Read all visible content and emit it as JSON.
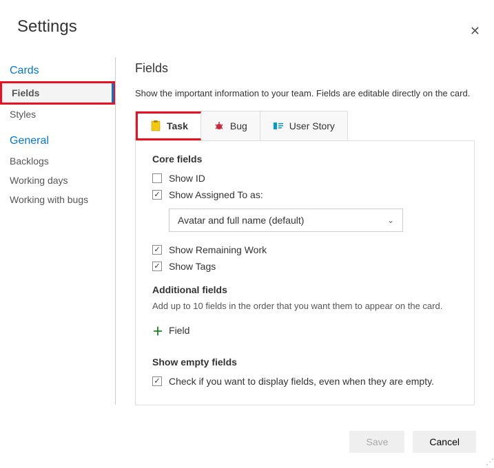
{
  "window": {
    "title": "Settings"
  },
  "sidebar": {
    "section_cards": "Cards",
    "item_fields": "Fields",
    "item_styles": "Styles",
    "section_general": "General",
    "item_backlogs": "Backlogs",
    "item_working_days": "Working days",
    "item_working_bugs": "Working with bugs"
  },
  "main": {
    "heading": "Fields",
    "description": "Show the important information to your team. Fields are editable directly on the card.",
    "tabs": {
      "task": "Task",
      "bug": "Bug",
      "user_story": "User Story"
    },
    "core_fields_label": "Core fields",
    "show_id": "Show ID",
    "show_assigned": "Show Assigned To as:",
    "assigned_select": "Avatar and full name (default)",
    "show_remaining": "Show Remaining Work",
    "show_tags": "Show Tags",
    "additional_label": "Additional fields",
    "additional_desc": "Add up to 10 fields in the order that you want them to appear on the card.",
    "add_field_label": "Field",
    "empty_label": "Show empty fields",
    "empty_check": "Check if you want to display fields, even when they are empty."
  },
  "footer": {
    "save": "Save",
    "cancel": "Cancel"
  }
}
